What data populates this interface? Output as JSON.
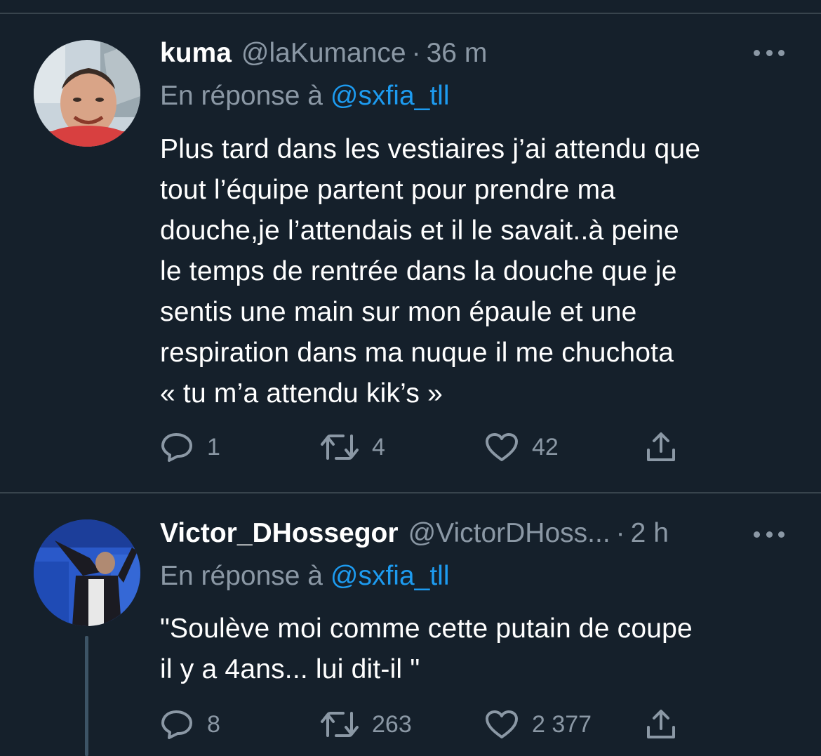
{
  "tweets": [
    {
      "display_name": "kuma",
      "handle": "@laKumance",
      "separator": "·",
      "time": "36 m",
      "reply_prefix": "En réponse à",
      "reply_to": "@sxfia_tll",
      "text": "Plus tard dans les vestiaires j’ai attendu que\ntout l’équipe partent pour prendre ma\ndouche,je l’attendais et il le savait..à peine\nle temps de rentrée dans la douche que je\nsentis une main sur mon épaule et une\nrespiration dans ma nuque il me chuchota\n« tu m’a attendu kik’s »",
      "replies": "1",
      "retweets": "4",
      "likes": "42"
    },
    {
      "display_name": "Victor_DHossegor",
      "handle": "@VictorDHoss...",
      "separator": "·",
      "time": "2 h",
      "reply_prefix": "En réponse à",
      "reply_to": "@sxfia_tll",
      "text": "\"Soulève moi comme cette putain de coupe\nil y a 4ans... lui dit-il \"",
      "replies": "8",
      "retweets": "263",
      "likes": "2 377"
    }
  ],
  "icons": {
    "reply": "speech-bubble-icon",
    "retweet": "retweet-arrows-icon",
    "like": "heart-outline-icon",
    "share": "share-upload-icon",
    "more": "three-dots-icon"
  },
  "colors": {
    "background": "#15202b",
    "text": "#ffffff",
    "secondary": "#8b98a5",
    "link": "#1d9bf0",
    "divider": "#38444d"
  }
}
